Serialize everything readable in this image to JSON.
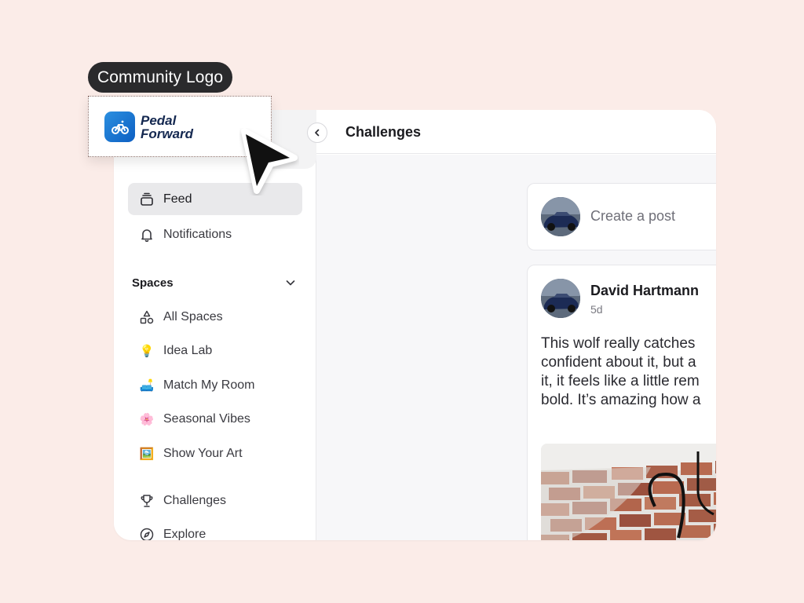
{
  "callout": {
    "tag_label": "Community Logo"
  },
  "brand": {
    "name_line1": "Pedal",
    "name_line2": "Forward",
    "color": "#1a73d9"
  },
  "header": {
    "title": "Challenges"
  },
  "sidebar": {
    "nav": [
      {
        "label": "Feed",
        "icon": "feed-icon",
        "active": true
      },
      {
        "label": "Notifications",
        "icon": "bell-icon",
        "active": false
      }
    ],
    "spaces_heading": "Spaces",
    "spaces": [
      {
        "label": "All Spaces",
        "icon": "shapes-icon"
      },
      {
        "label": "Idea Lab",
        "icon": "💡"
      },
      {
        "label": "Match My Room",
        "icon": "🛋️"
      },
      {
        "label": "Seasonal Vibes",
        "icon": "🌸"
      },
      {
        "label": "Show Your Art",
        "icon": "🖼️"
      }
    ],
    "footer_nav": [
      {
        "label": "Challenges",
        "icon": "trophy-icon"
      },
      {
        "label": "Explore",
        "icon": "compass-icon"
      }
    ]
  },
  "composer": {
    "placeholder": "Create a post"
  },
  "post": {
    "author": "David Hartmann",
    "time": "5d",
    "text_lines": [
      "This wolf really catches",
      "confident about it, but a",
      "it, it feels like a little rem",
      "bold. It’s amazing how a"
    ]
  }
}
